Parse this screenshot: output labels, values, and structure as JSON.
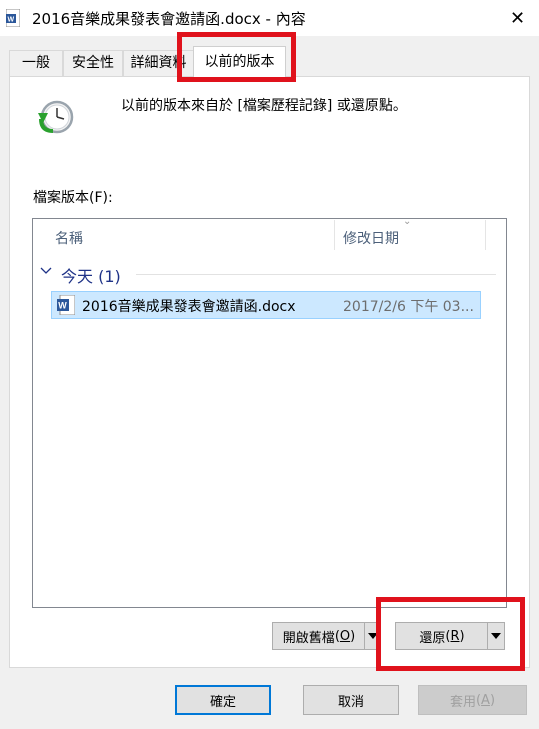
{
  "window": {
    "title": "2016音樂成果發表會邀請函.docx - 內容",
    "close_glyph": "✕"
  },
  "tabs": [
    {
      "label": "一般"
    },
    {
      "label": "安全性"
    },
    {
      "label": "詳細資料"
    },
    {
      "label": "以前的版本"
    }
  ],
  "panel": {
    "info_text": "以前的版本來自於 [檔案歷程記錄] 或還原點。",
    "versions_label": "檔案版本(F):",
    "columns": [
      "名稱",
      "修改日期"
    ],
    "group": {
      "label": "今天 (1)"
    },
    "files": [
      {
        "name": "2016音樂成果發表會邀請函.docx",
        "date": "2017/2/6 下午 03..."
      }
    ]
  },
  "buttons": {
    "open_old_label": "開啟舊檔",
    "open_old_key": "O",
    "restore_label": "還原",
    "restore_key": "R",
    "ok": "確定",
    "cancel": "取消",
    "apply_label": "套用",
    "apply_key": "A"
  },
  "colors": {
    "highlight": "#e0121c",
    "accent": "#0078d7",
    "selection": "#cce8ff",
    "group_text": "#1e3287"
  },
  "icons": [
    "word-document-icon",
    "close-icon",
    "history-clock-icon",
    "chevron-down-icon",
    "dropdown-arrow-icon"
  ]
}
